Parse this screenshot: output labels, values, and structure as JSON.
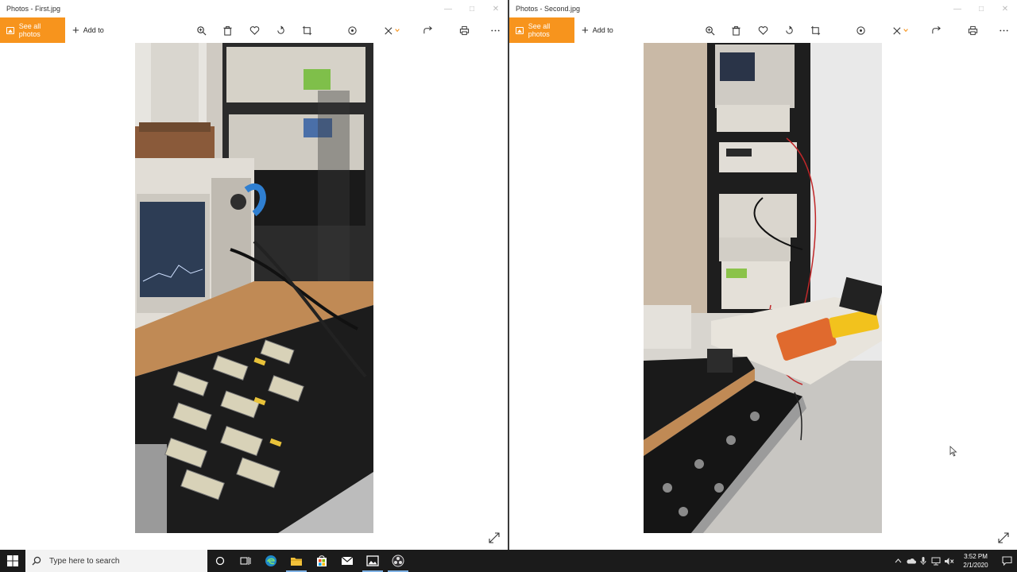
{
  "windows": [
    {
      "title": "Photos - First.jpg",
      "see_all_label": "See all photos",
      "add_to_label": "Add to"
    },
    {
      "title": "Photos - Second.jpg",
      "see_all_label": "See all photos",
      "add_to_label": "Add to"
    }
  ],
  "toolbar_icons": [
    "zoom-icon",
    "delete-icon",
    "favorite-icon",
    "rotate-icon",
    "crop-icon",
    "enhance-icon",
    "edit-create-icon",
    "share-icon",
    "print-icon",
    "more-icon"
  ],
  "taskbar": {
    "search_placeholder": "Type here to search",
    "time": "3:52 PM",
    "date": "2/1/2020"
  },
  "colors": {
    "accent": "#f7941d",
    "taskbar": "#1b1b1b"
  }
}
